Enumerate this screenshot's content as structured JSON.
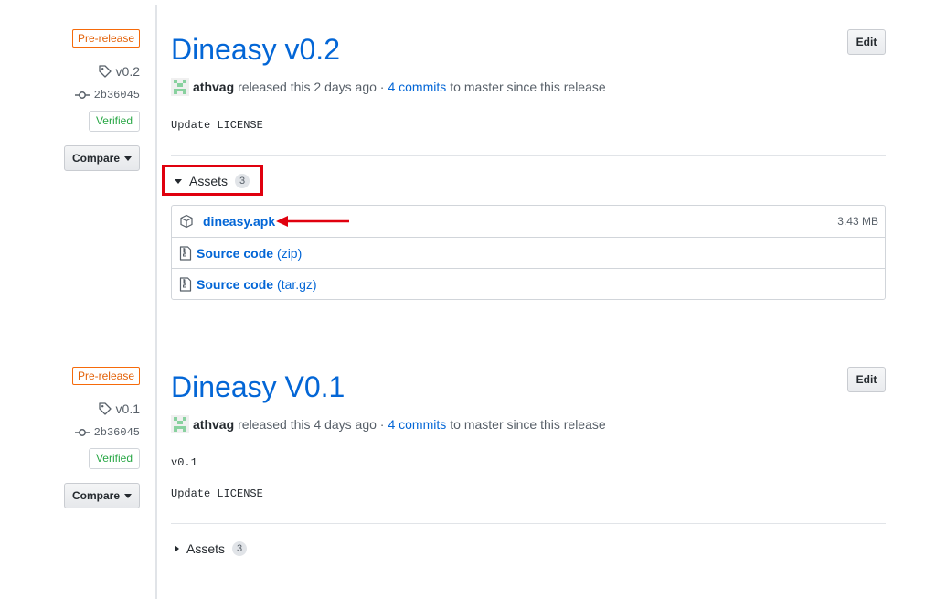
{
  "releases": [
    {
      "prerelease_label": "Pre-release",
      "tag": "v0.2",
      "commit": "2b36045",
      "verified_label": "Verified",
      "compare_label": "Compare",
      "title": "Dineasy v0.2",
      "edit_label": "Edit",
      "author": "athvag",
      "released_text": "released this 2 days ago ·",
      "commits_link": "4 commits",
      "since_text": "to master since this release",
      "body": [
        "Update LICENSE"
      ],
      "assets_label": "Assets",
      "assets_count": "3",
      "assets_expanded": true,
      "assets": [
        {
          "name": "dineasy.apk",
          "ext": "",
          "size": "3.43 MB",
          "icon": "package-icon"
        },
        {
          "name": "Source code",
          "ext": "(zip)",
          "size": "",
          "icon": "file-zip-icon"
        },
        {
          "name": "Source code",
          "ext": "(tar.gz)",
          "size": "",
          "icon": "file-zip-icon"
        }
      ]
    },
    {
      "prerelease_label": "Pre-release",
      "tag": "v0.1",
      "commit": "2b36045",
      "verified_label": "Verified",
      "compare_label": "Compare",
      "title": "Dineasy V0.1",
      "edit_label": "Edit",
      "author": "athvag",
      "released_text": "released this 4 days ago ·",
      "commits_link": "4 commits",
      "since_text": "to master since this release",
      "body": [
        "v0.1",
        "Update LICENSE"
      ],
      "assets_label": "Assets",
      "assets_count": "3",
      "assets_expanded": false
    }
  ],
  "colors": {
    "link": "#0366d6",
    "prerelease": "#e36209",
    "verified": "#28a745",
    "annotation": "#e0000e"
  }
}
